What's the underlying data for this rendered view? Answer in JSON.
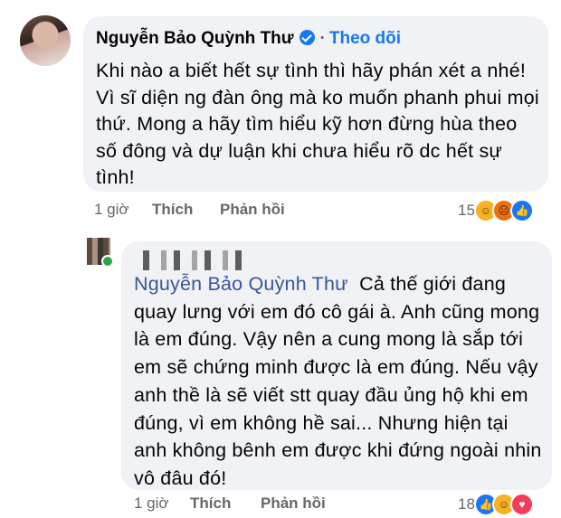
{
  "comment1": {
    "author": "Nguyễn Bảo Quỳnh Thư",
    "follow_label": "Theo dõi",
    "text": "Khi nào a biết hết sự tình thì hãy phán xét a nhé! Vì sĩ diện ng đàn ông mà ko muốn phanh phui mọi thứ. Mong a hãy tìm hiểu kỹ hơn đừng hùa theo số đông và dự luận khi chưa hiểu rõ dc hết sự tình!",
    "time": "1 giờ",
    "like_label": "Thích",
    "reply_label": "Phản hồi",
    "reaction_count": "15",
    "reactions": [
      "haha-icon",
      "angry-icon",
      "like-icon"
    ]
  },
  "comment2": {
    "mention": "Nguyễn Bảo Quỳnh Thư",
    "text": "Cả thế giới đang quay lưng với em đó cô gái à. Anh cũng mong là em đúng. Vậy nên a cung mong là sắp tới em sẽ chứng minh được là em đúng. Nếu vậy anh thề là sẽ viết stt quay đầu ủng hộ khi em đúng, vì em không hề sai... Nhưng hiện tại anh không bênh em được khi đứng ngoài nhin vô đâu đó!",
    "time": "1 giờ",
    "like_label": "Thích",
    "reply_label": "Phản hồi",
    "reaction_count": "18",
    "reactions": [
      "like-icon",
      "haha-icon",
      "love-icon"
    ]
  },
  "colors": {
    "bubble": "#f0f2f5",
    "link": "#1877f2",
    "mention": "#385898",
    "meta": "#65676b"
  }
}
